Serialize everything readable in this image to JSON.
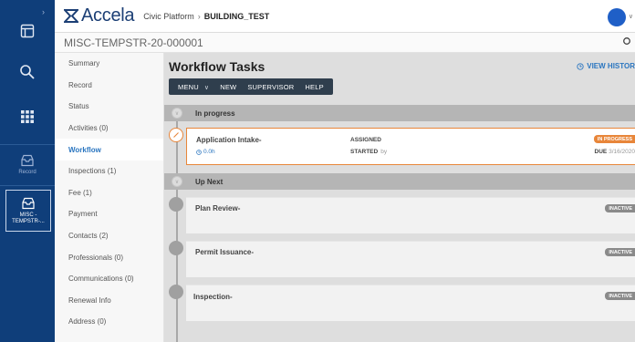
{
  "app": {
    "brand": "Accela",
    "breadcrumb": [
      "Civic Platform",
      "BUILDING_TEST"
    ]
  },
  "rail": {
    "record_label": "Record",
    "active_label": "MISC -TEMPSTR-..."
  },
  "record": {
    "id": "MISC-TEMPSTR-20-000001"
  },
  "sidenav": {
    "items": [
      "Summary",
      "Record",
      "Status",
      "Activities (0)",
      "Workflow",
      "Inspections (1)",
      "Fee (1)",
      "Payment",
      "Contacts (2)",
      "Professionals (0)",
      "Communications (0)",
      "Renewal Info",
      "Address (0)"
    ],
    "active": "Workflow"
  },
  "workflow": {
    "title": "Workflow Tasks",
    "view_history": "VIEW HISTOR",
    "toolbar": {
      "menu": "MENU",
      "new": "NEW",
      "supervisor": "SUPERVISOR",
      "help": "HELP"
    },
    "in_progress_label": "In progress",
    "up_next_label": "Up Next",
    "active_task": {
      "name": "Application Intake-",
      "duration": "0.0h",
      "assigned_label": "ASSIGNED",
      "started_label": "STARTED",
      "started_by": "by",
      "status": "IN PROGRESS",
      "due_label": "DUE",
      "due_date": "3/16/2020"
    },
    "next_tasks": [
      {
        "name": "Plan Review-",
        "status": "INACTIVE"
      },
      {
        "name": "Permit Issuance-",
        "status": "INACTIVE"
      },
      {
        "name": "Inspection-",
        "status": "INACTIVE"
      }
    ]
  },
  "colors": {
    "rail": "#0f3e7a",
    "accent": "#2b76c0",
    "in_progress": "#e8863a",
    "inactive": "#8a8a8a",
    "avatar": "#1f5fc7"
  }
}
